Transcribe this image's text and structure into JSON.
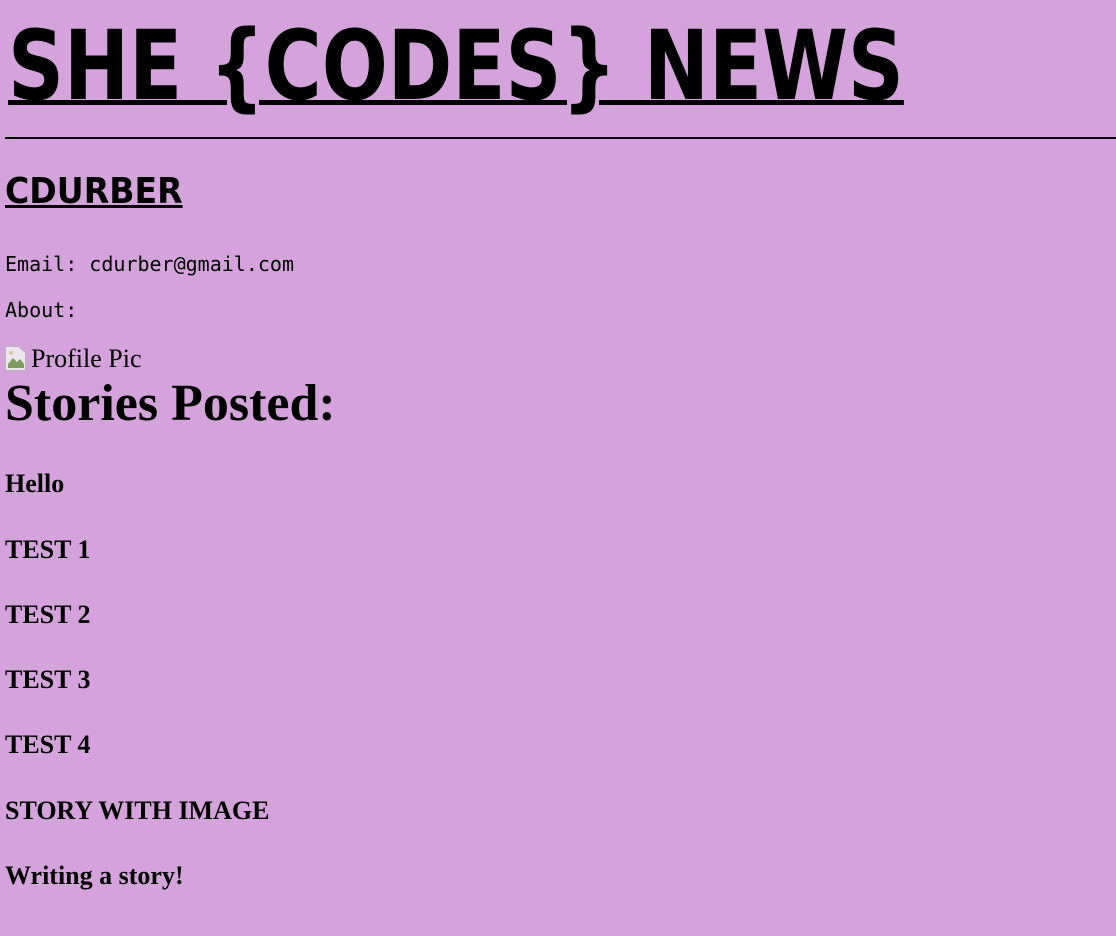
{
  "header": {
    "site_title": "SHE {CODES} NEWS"
  },
  "profile": {
    "username": "CDURBER",
    "email_label": "Email:",
    "email_value": "cdurber@gmail.com",
    "about_label": "About:",
    "about_value": "",
    "profile_pic_alt": "Profile Pic",
    "profile_pic_icon": "broken-image-icon"
  },
  "stories": {
    "heading": "Stories Posted:",
    "items": [
      "Hello",
      "TEST 1",
      "TEST 2",
      "TEST 3",
      "TEST 4",
      "STORY WITH IMAGE",
      "Writing a story!"
    ]
  },
  "colors": {
    "background": "#d5a3dc",
    "text": "#000000"
  }
}
